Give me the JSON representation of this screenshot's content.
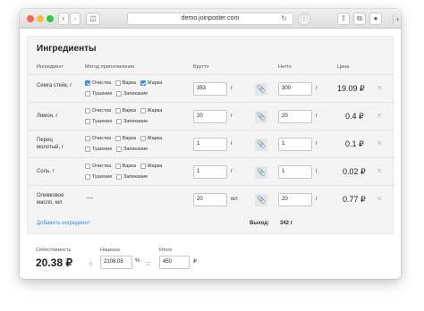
{
  "browser": {
    "url": "demo.joinposter.com",
    "back_icon": "chevron-left",
    "forward_icon": "chevron-right",
    "sidebar_icon": "sidebar",
    "reload_icon": "reload",
    "info_icon": "info",
    "share_icon": "share",
    "tabs_icon": "tabs",
    "download_icon": "download",
    "plus_label": "+"
  },
  "title": "Ингредиенты",
  "columns": {
    "ingredient": "Ингредиент",
    "method": "Метод приготовления",
    "gross": "Брутто",
    "net": "Нетто",
    "price": "Цена"
  },
  "methods_labels": {
    "clean": "Очистка",
    "boil": "Варка",
    "fry": "Жарка",
    "stew": "Тушение",
    "bake": "Запекание"
  },
  "rows": [
    {
      "name": "Семга стейк, г",
      "methods": {
        "clean": true,
        "boil": false,
        "fry": true,
        "stew": false,
        "bake": false
      },
      "gross": "353",
      "gross_unit": "г",
      "net": "300",
      "net_unit": "г",
      "price": "19.09 ₽"
    },
    {
      "name": "Лимон, г",
      "methods": {
        "clean": false,
        "boil": false,
        "fry": false,
        "stew": false,
        "bake": false
      },
      "gross": "20",
      "gross_unit": "г",
      "net": "20",
      "net_unit": "г",
      "price": "0.4 ₽"
    },
    {
      "name": "Перец молотый, г",
      "methods": {
        "clean": false,
        "boil": false,
        "fry": false,
        "stew": false,
        "bake": false
      },
      "gross": "1",
      "gross_unit": "г",
      "net": "1",
      "net_unit": "г",
      "price": "0.1 ₽"
    },
    {
      "name": "Соль, г",
      "methods": {
        "clean": false,
        "boil": false,
        "fry": false,
        "stew": false,
        "bake": false
      },
      "gross": "1",
      "gross_unit": "г",
      "net": "1",
      "net_unit": "г",
      "price": "0.02 ₽"
    },
    {
      "name": "Оливковое масло, мл",
      "method_text": "—",
      "gross": "20",
      "gross_unit": "мл",
      "net": "20",
      "net_unit": "г",
      "price": "0.77 ₽"
    }
  ],
  "add_ingredient": "Добавить ингредиент",
  "yield_label": "Выход:",
  "yield_value": "342 г",
  "footer": {
    "cost_label": "Себестоимость",
    "cost_value": "20.38 ₽",
    "plus": "+",
    "markup_label": "Наценка",
    "markup_value": "2108.05",
    "markup_unit": "%",
    "equals": "=",
    "total_label": "Итого",
    "total_value": "450",
    "total_unit": "₽"
  }
}
